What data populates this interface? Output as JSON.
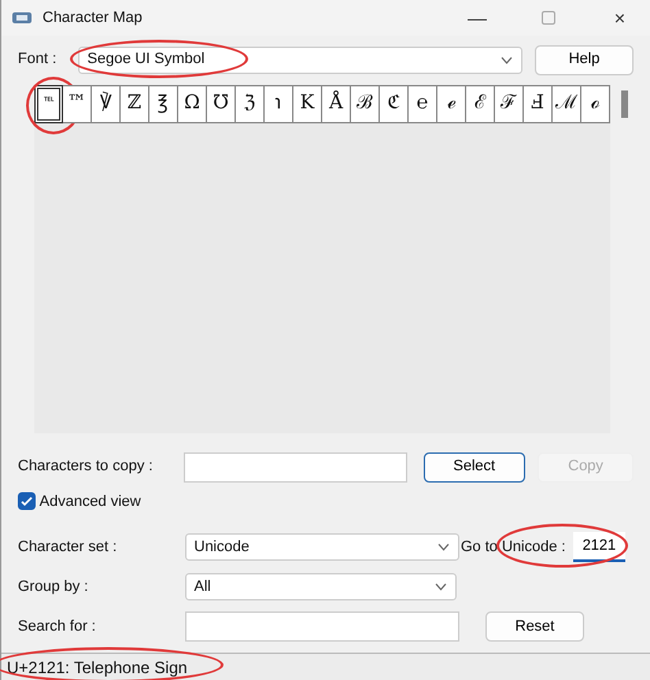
{
  "window": {
    "title": "Character Map",
    "buttons": [
      "—",
      "×"
    ]
  },
  "font": {
    "label": "Font :",
    "value": "Segoe UI Symbol",
    "highlighted": true
  },
  "help_button": "Help",
  "characters": [
    {
      "glyph": "℡",
      "selected": true,
      "highlighted": true
    },
    {
      "glyph": "™",
      "selected": false,
      "highlighted": false
    },
    {
      "glyph": "℣",
      "selected": false,
      "highlighted": false
    },
    {
      "glyph": "ℤ",
      "selected": false,
      "highlighted": false
    },
    {
      "glyph": "℥",
      "selected": false,
      "highlighted": false
    },
    {
      "glyph": "Ω",
      "selected": false,
      "highlighted": false
    },
    {
      "glyph": "℧",
      "selected": false,
      "highlighted": false
    },
    {
      "glyph": "ℨ",
      "selected": false,
      "highlighted": false
    },
    {
      "glyph": "℩",
      "selected": false,
      "highlighted": false
    },
    {
      "glyph": "K",
      "selected": false,
      "highlighted": false
    },
    {
      "glyph": "Å",
      "selected": false,
      "highlighted": false
    },
    {
      "glyph": "ℬ",
      "selected": false,
      "highlighted": false
    },
    {
      "glyph": "ℭ",
      "selected": false,
      "highlighted": false
    },
    {
      "glyph": "℮",
      "selected": false,
      "highlighted": false
    },
    {
      "glyph": "ℯ",
      "selected": false,
      "highlighted": false
    },
    {
      "glyph": "ℰ",
      "selected": false,
      "highlighted": false
    },
    {
      "glyph": "ℱ",
      "selected": false,
      "highlighted": false
    },
    {
      "glyph": "Ⅎ",
      "selected": false,
      "highlighted": false
    },
    {
      "glyph": "ℳ",
      "selected": false,
      "highlighted": false
    },
    {
      "glyph": "ℴ",
      "selected": false,
      "highlighted": false
    }
  ],
  "copy": {
    "label": "Characters to copy :",
    "select_button": "Select",
    "copy_button": "Copy",
    "copy_disabled": true
  },
  "advanced_view": {
    "label": "Advanced view",
    "checked": true
  },
  "character_set": {
    "label": "Character set :",
    "value": "Unicode"
  },
  "go_to_unicode": {
    "label": "Go to Unicode :",
    "value": "2121",
    "highlighted": true
  },
  "group_by": {
    "label": "Group by :",
    "value": "All"
  },
  "search": {
    "label": "Search for :",
    "reset_button": "Reset"
  },
  "status_bar": {
    "text": "U+2121: Telephone Sign",
    "highlighted": true
  }
}
